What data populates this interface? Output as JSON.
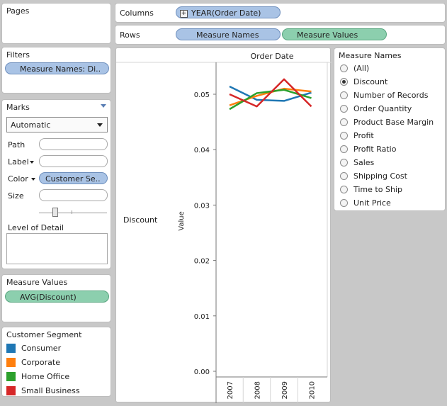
{
  "pages": {
    "title": "Pages"
  },
  "filters": {
    "title": "Filters",
    "pill": "Measure Names: Di.."
  },
  "marks": {
    "title": "Marks",
    "mark_type": "Automatic",
    "path_label": "Path",
    "label_label": "Label",
    "color_label": "Color",
    "color_pill": "Customer Se..",
    "size_label": "Size",
    "level_of_detail": "Level of Detail"
  },
  "measure_values": {
    "title": "Measure Values",
    "pill": "AVG(Discount)"
  },
  "customer_segment_legend": {
    "title": "Customer Segment",
    "items": [
      {
        "label": "Consumer",
        "color": "#1f77b4"
      },
      {
        "label": "Corporate",
        "color": "#ff7f0e"
      },
      {
        "label": "Home Office",
        "color": "#2ca02c"
      },
      {
        "label": "Small Business",
        "color": "#d62728"
      }
    ]
  },
  "shelves": {
    "columns_label": "Columns",
    "columns_pill": "YEAR(Order Date)",
    "columns_pill_icon": "+",
    "rows_label": "Rows",
    "rows_pills": [
      "Measure Names",
      "Measure Values"
    ]
  },
  "measure_names": {
    "title": "Measure Names",
    "selected": "Discount",
    "options": [
      "(All)",
      "Discount",
      "Number of Records",
      "Order Quantity",
      "Product Base Margin",
      "Profit",
      "Profit Ratio",
      "Sales",
      "Shipping Cost",
      "Time to Ship",
      "Unit Price"
    ]
  },
  "chart_data": {
    "type": "line",
    "header": "Order Date",
    "row_label": "Discount",
    "ylabel": "Value",
    "categories": [
      "2007",
      "2008",
      "2009",
      "2010"
    ],
    "ylim": [
      0,
      0.055
    ],
    "yticks": [
      "0.05",
      "0.04",
      "0.03",
      "0.02",
      "0.01",
      "0.00"
    ],
    "ytick_values": [
      0.05,
      0.04,
      0.03,
      0.02,
      0.01,
      0.0
    ],
    "series": [
      {
        "name": "Consumer",
        "color": "#1f77b4",
        "values": [
          0.0514,
          0.049,
          0.0488,
          0.0503
        ]
      },
      {
        "name": "Corporate",
        "color": "#ff7f0e",
        "values": [
          0.048,
          0.0497,
          0.051,
          0.0505
        ]
      },
      {
        "name": "Home Office",
        "color": "#2ca02c",
        "values": [
          0.0473,
          0.0502,
          0.0508,
          0.0493
        ]
      },
      {
        "name": "Small Business",
        "color": "#d62728",
        "values": [
          0.05,
          0.0478,
          0.0527,
          0.0478
        ]
      }
    ]
  }
}
